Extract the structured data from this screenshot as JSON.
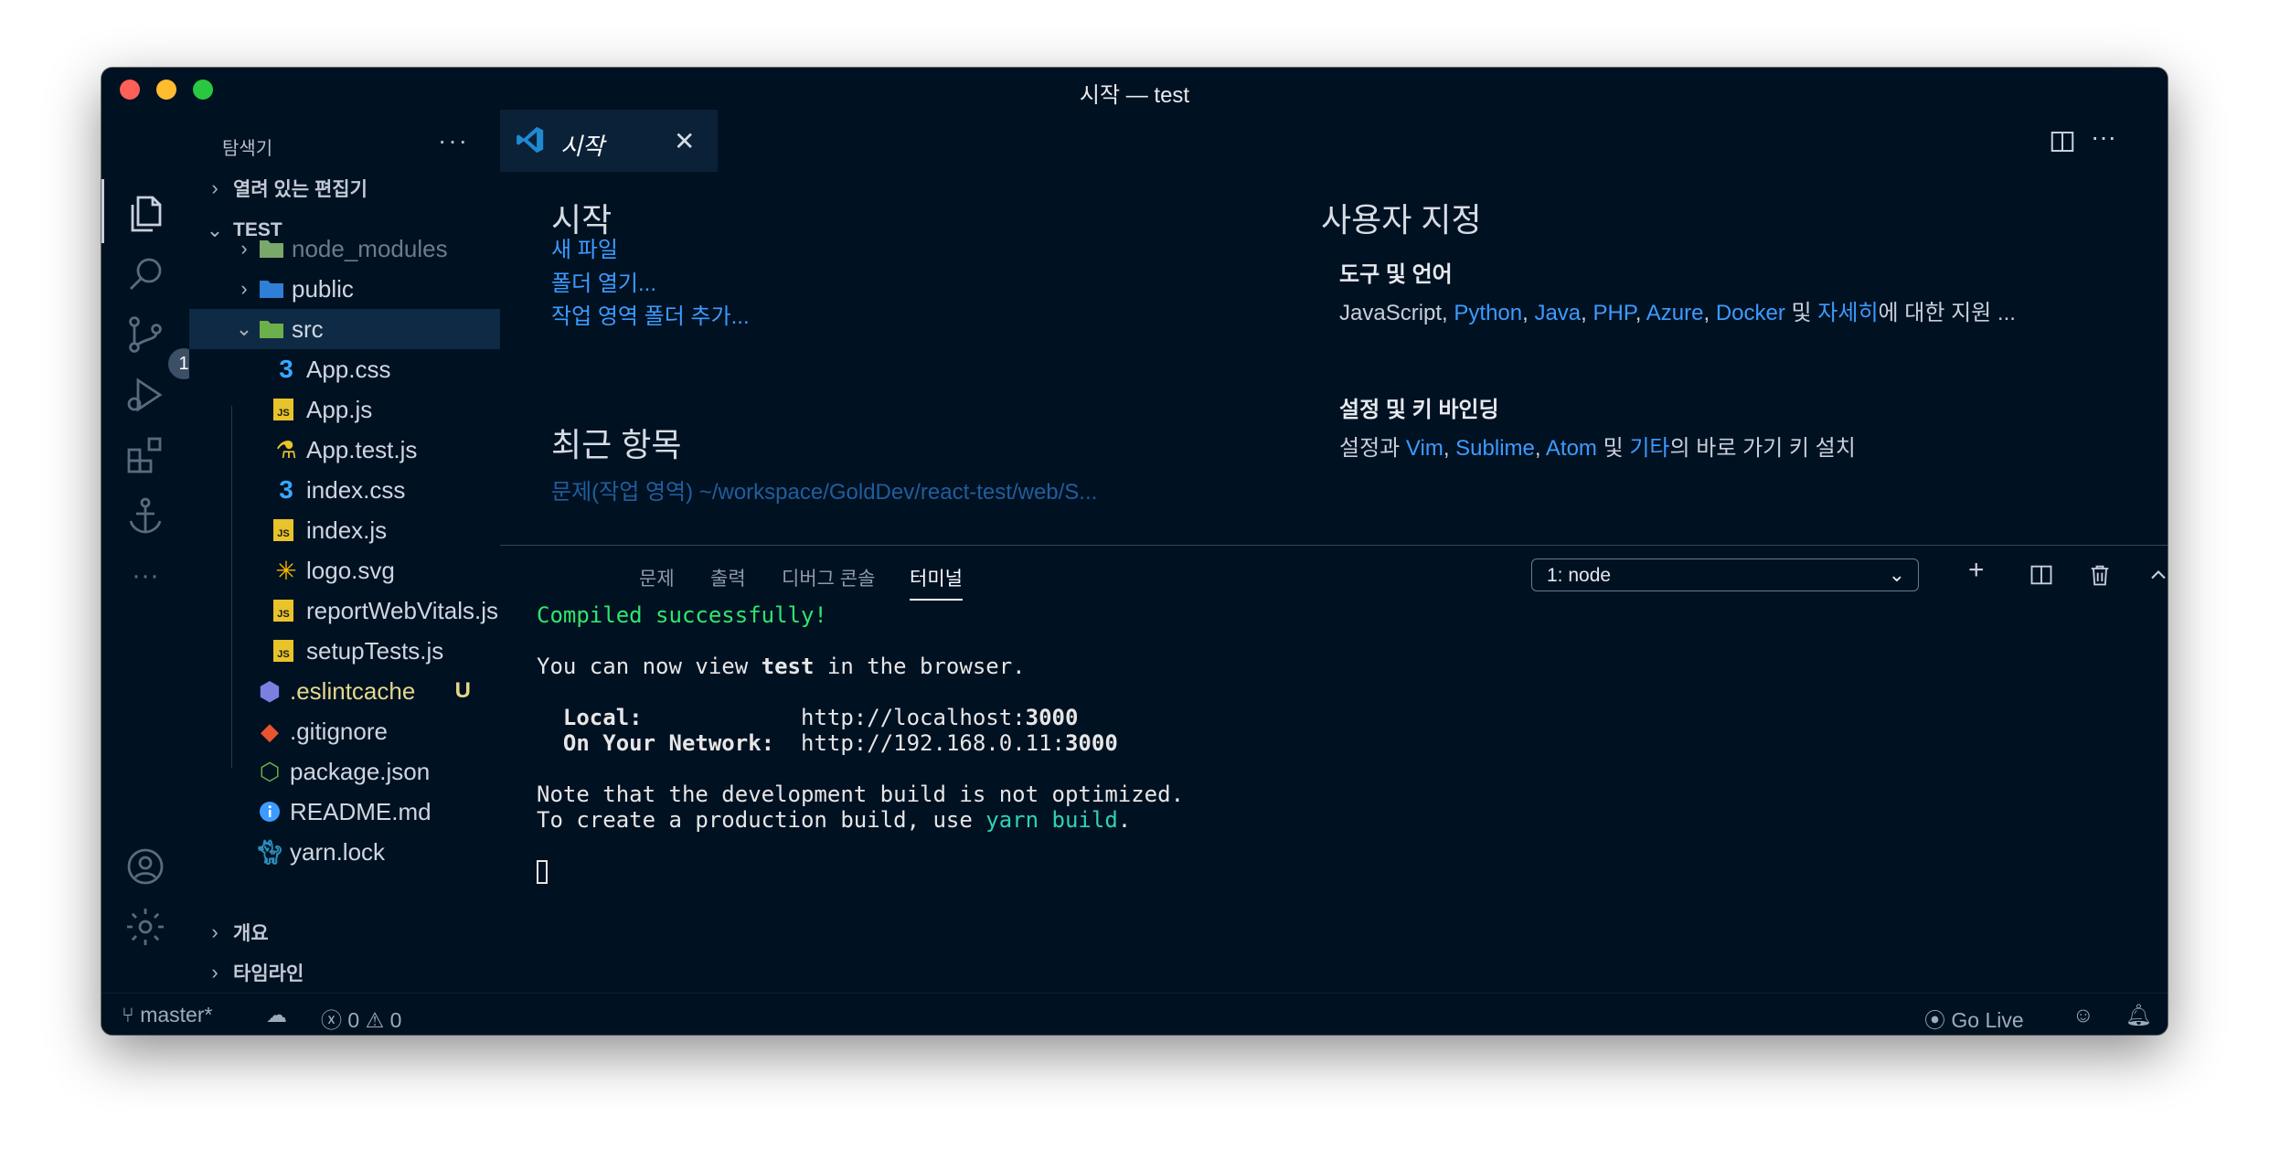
{
  "window": {
    "title": "시작 — test"
  },
  "activity": {
    "items": [
      "explorer-icon",
      "search-icon",
      "source-control-icon",
      "run-debug-icon",
      "extensions-icon",
      "anchor-icon",
      "more-icon",
      "account-icon",
      "settings-gear-icon"
    ],
    "scm_badge": "1"
  },
  "sidebar": {
    "title": "탐색기",
    "more": "···",
    "open_editors": "열려 있는 편집기",
    "project": "TEST",
    "tree": [
      {
        "name": "node_modules",
        "type": "folder",
        "icon": "node-folder-icon",
        "color": "#7aa86a"
      },
      {
        "name": "public",
        "type": "folder",
        "icon": "public-folder-icon",
        "color": "#2f7fd6"
      },
      {
        "name": "src",
        "type": "folder-open",
        "icon": "src-folder-icon",
        "color": "#6cb04b"
      },
      {
        "name": "App.css",
        "type": "css",
        "icon": "css-icon"
      },
      {
        "name": "App.js",
        "type": "js",
        "icon": "js-icon"
      },
      {
        "name": "App.test.js",
        "type": "test",
        "icon": "test-flask-icon"
      },
      {
        "name": "index.css",
        "type": "css",
        "icon": "css-icon"
      },
      {
        "name": "index.js",
        "type": "js",
        "icon": "js-icon"
      },
      {
        "name": "logo.svg",
        "type": "svg",
        "icon": "svg-icon"
      },
      {
        "name": "reportWebVitals.js",
        "type": "js",
        "icon": "js-icon"
      },
      {
        "name": "setupTests.js",
        "type": "js",
        "icon": "js-icon"
      },
      {
        "name": ".eslintcache",
        "type": "file",
        "icon": "eslint-icon",
        "badge": "U"
      },
      {
        "name": ".gitignore",
        "type": "file",
        "icon": "git-icon"
      },
      {
        "name": "package.json",
        "type": "file",
        "icon": "nodejs-icon"
      },
      {
        "name": "README.md",
        "type": "file",
        "icon": "info-icon"
      },
      {
        "name": "yarn.lock",
        "type": "file",
        "icon": "yarn-icon"
      }
    ],
    "outline": "개요",
    "timeline": "타임라인"
  },
  "tab": {
    "label": "시작",
    "close": "✕"
  },
  "welcome": {
    "start_heading": "시작",
    "new_file": "새 파일",
    "open_folder": "폴더 열기...",
    "add_workspace": "작업 영역 폴더 추가...",
    "recent_heading": "최근 항목",
    "custom_heading": "사용자 지정",
    "tools_title": "도구 및 언어",
    "tools_prefix": "JavaScript, ",
    "tools_links": [
      "Python",
      "Java",
      "PHP",
      "Azure",
      "Docker"
    ],
    "tools_and": " 및 ",
    "tools_more": "자세히",
    "tools_suffix": "에 대한 지원 ...",
    "keys_title": "설정 및 키 바인딩",
    "keys_prefix": "설정과 ",
    "keys_links": [
      "Vim",
      "Sublime",
      "Atom"
    ],
    "keys_and": " 및 ",
    "keys_other": "기타",
    "keys_suffix": "의 바로 가기 키 설치"
  },
  "panel": {
    "tabs": [
      "문제",
      "출력",
      "디버그 콘솔",
      "터미널"
    ],
    "terminal_select": "1: node",
    "terminal": {
      "compiled": "Compiled successfully!",
      "view_pre": "You can now view ",
      "view_app": "test",
      "view_post": " in the browser.",
      "local_label": "Local:",
      "local_url_pre": "http://localhost:",
      "local_port": "3000",
      "network_label": "On Your Network:",
      "network_url_pre": "http://192.168.0.11:",
      "network_port": "3000",
      "note": "Note that the development build is not optimized.",
      "prod_pre": "To create a production build, use ",
      "prod_cmd": "yarn build",
      "prod_post": "."
    }
  },
  "status": {
    "branch": "master*",
    "errors": "0",
    "warnings": "0",
    "go_live": "Go Live"
  }
}
